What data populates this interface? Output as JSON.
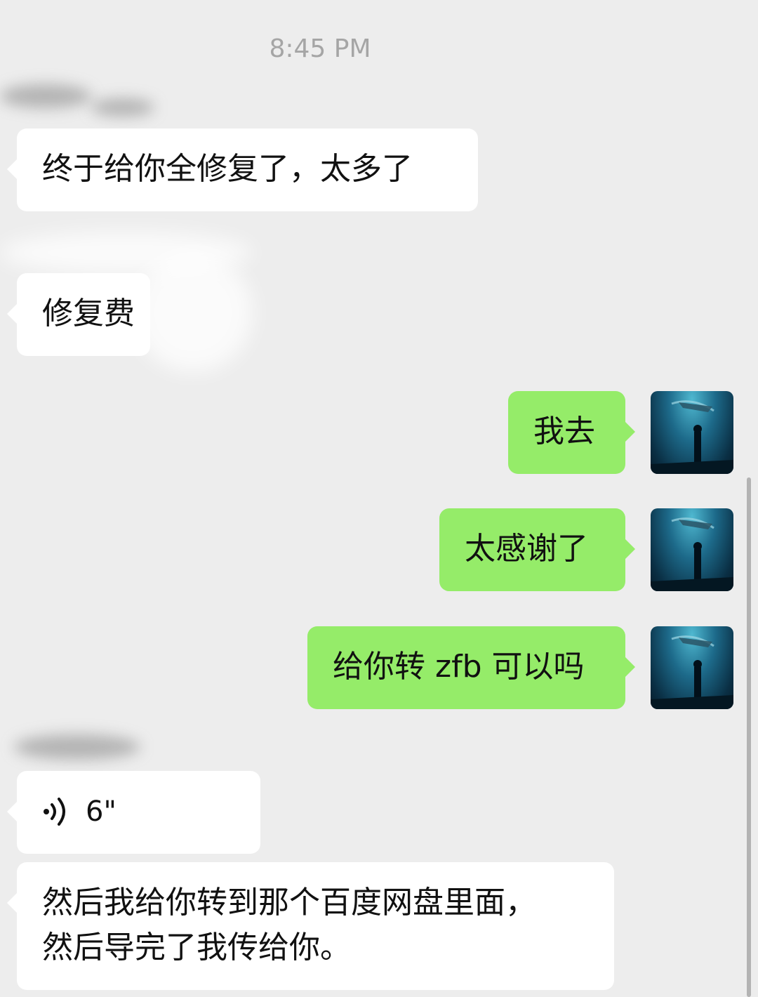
{
  "chat": {
    "timestamp": "8:45 PM",
    "messages": [
      {
        "id": "m1",
        "direction": "incoming",
        "text": "终于给你全修复了，太多了"
      },
      {
        "id": "m2",
        "direction": "incoming",
        "text": "修复费"
      },
      {
        "id": "m3",
        "direction": "outgoing",
        "text": "我去"
      },
      {
        "id": "m4",
        "direction": "outgoing",
        "text": "太感谢了"
      },
      {
        "id": "m5",
        "direction": "outgoing",
        "text": "给你转 zfb 可以吗"
      },
      {
        "id": "m6",
        "direction": "incoming",
        "type": "voice",
        "duration": "6\"",
        "icon": "voice-wave-icon"
      },
      {
        "id": "m7",
        "direction": "incoming",
        "lines": [
          "然后我给你转到那个百度网盘里面，",
          "然后导完了我传给你。"
        ]
      }
    ]
  },
  "colors": {
    "background": "#ededed",
    "incoming_bubble": "#ffffff",
    "outgoing_bubble": "#95ec69",
    "timestamp_text": "#a5a5a5"
  }
}
